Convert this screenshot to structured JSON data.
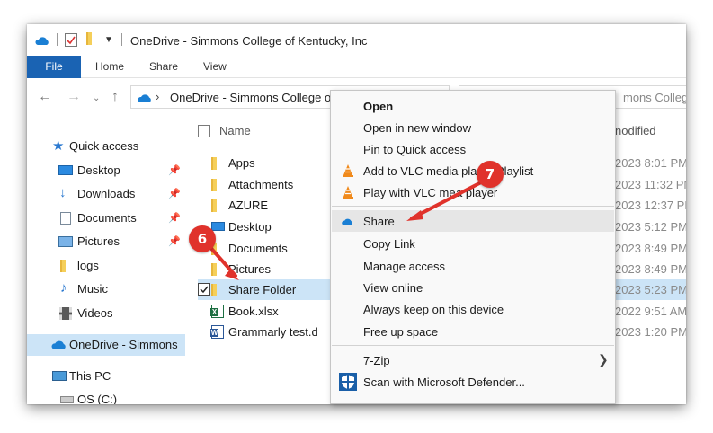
{
  "window": {
    "title": "OneDrive - Simmons College of Kentucky, Inc"
  },
  "ribbon": {
    "file_tab": "File",
    "tabs": [
      "Home",
      "Share",
      "View"
    ]
  },
  "address": {
    "breadcrumb": "OneDrive - Simmons College o",
    "search_text": "mons College"
  },
  "navpane": {
    "quick_access": "Quick access",
    "items": [
      {
        "label": "Desktop",
        "icon": "desktop-icon",
        "pinned": true
      },
      {
        "label": "Downloads",
        "icon": "download-icon",
        "pinned": true
      },
      {
        "label": "Documents",
        "icon": "document-icon",
        "pinned": true
      },
      {
        "label": "Pictures",
        "icon": "pictures-icon",
        "pinned": true
      },
      {
        "label": "logs",
        "icon": "folder-icon",
        "pinned": false
      },
      {
        "label": "Music",
        "icon": "music-icon",
        "pinned": false
      },
      {
        "label": "Videos",
        "icon": "videos-icon",
        "pinned": false
      }
    ],
    "onedrive": "OneDrive - Simmons",
    "this_pc": "This PC",
    "os_drive": "OS (C:)"
  },
  "filelist": {
    "name_header": "Name",
    "date_header": "nodified",
    "rows": [
      {
        "name": "Apps",
        "icon": "folder-icon",
        "date": "2023 8:01 PM"
      },
      {
        "name": "Attachments",
        "icon": "folder-icon",
        "date": "2023 11:32 PM"
      },
      {
        "name": "AZURE",
        "icon": "folder-icon",
        "date": "2023 12:37 PM"
      },
      {
        "name": "Desktop",
        "icon": "desktop-icon",
        "date": "2023 5:12 PM"
      },
      {
        "name": "Documents",
        "icon": "folder-icon",
        "date": "2023 8:49 PM"
      },
      {
        "name": "Pictures",
        "icon": "folder-icon",
        "date": "2023 8:49 PM"
      },
      {
        "name": "Share Folder",
        "icon": "folder-icon",
        "date": "2023 5:23 PM",
        "selected": true
      },
      {
        "name": "Book.xlsx",
        "icon": "excel-icon",
        "date": "2022 9:51 AM"
      },
      {
        "name": "Grammarly test.d",
        "icon": "word-icon",
        "date": "2023 1:20 PM"
      }
    ]
  },
  "context_menu": {
    "items": [
      {
        "label": "Open",
        "bold": true
      },
      {
        "label": "Open in new window"
      },
      {
        "label": "Pin to Quick access"
      },
      {
        "label": "Add to VLC media pla",
        "suffix": "Playlist",
        "icon": "vlc-icon"
      },
      {
        "label": "Play with VLC me",
        "suffix": "a player",
        "icon": "vlc-icon"
      },
      {
        "label": "Share",
        "icon": "onedrive-cloud-icon",
        "hover": true
      },
      {
        "label": "Copy Link"
      },
      {
        "label": "Manage access"
      },
      {
        "label": "View online"
      },
      {
        "label": "Always keep on this device"
      },
      {
        "label": "Free up space"
      },
      {
        "label": "7-Zip",
        "submenu": true
      },
      {
        "label": "Scan with Microsoft Defender...",
        "icon": "defender-shield-icon"
      }
    ]
  },
  "annotations": {
    "step6": "6",
    "step7": "7",
    "color": "#e0322b"
  },
  "colors": {
    "accent": "#1a63b3",
    "selection": "#cce4f7",
    "folder": "#f5cf5a",
    "onedrive": "#1a7fd4"
  }
}
